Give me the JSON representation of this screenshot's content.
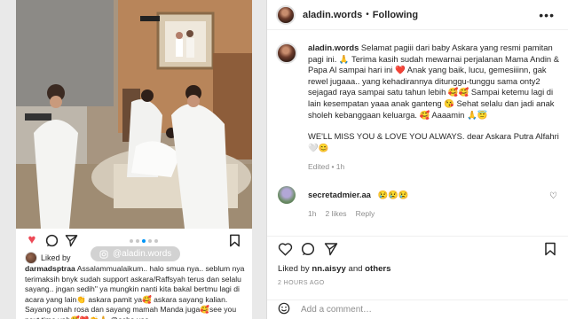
{
  "mobile": {
    "liked_by_prefix": "Liked by",
    "watermark": "@aladin.words",
    "caption_user": "darmadsptraa",
    "caption_text": "Assalammualaikum.. halo smua nya.. seblum nya terimaksih bnyk sudah support askara/Raffsyah terus dan selalu sayang.. jngan sedih\" ya mungkin nanti kita bakal bertmu lagi di acara yang lain👏 askara pamit ya🥰 askara sayang kalian. Sayang omah rosa dan sayang mamah Manda juga🥰see you next time yah🥰❤️👏🙏 @ocha.vaa",
    "icons": {
      "like": "heart-icon",
      "comment": "comment-icon",
      "share": "send-icon",
      "save": "bookmark-icon"
    }
  },
  "desktop": {
    "username": "aladin.words",
    "separator": "•",
    "follow_label": "Following",
    "more_label": "•••",
    "caption_user": "aladin.words",
    "caption_text": "Selamat pagiii dari baby Askara yang resmi pamitan pagi ini. 🙏 Terima kasih sudah mewarnai perjalanan Mama Andin & Papa Al sampai hari ini ❤️ Anak yang baik, lucu, gemesiiinn, gak rewel jugaaa.. yang kehadirannya ditunggu-tunggu sama onty2 sejagad raya sampai satu tahun lebih 🥰🥰 Sampai ketemu lagi di lain kesempatan yaaa anak ganteng 😘 Sehat selalu dan jadi anak sholeh kebanggaan keluarga. 🥰 Aaaamin 🙏😇",
    "caption_text_2": "WE'LL MISS YOU & LOVE YOU ALWAYS. dear Askara Putra Alfahri 🤍😊",
    "edited_label": "Edited • 1h",
    "comment": {
      "user": "secretadmier.aa",
      "text": "😢😢😢",
      "time": "1h",
      "likes": "2 likes",
      "reply": "Reply"
    },
    "liked_prefix": "Liked by",
    "liked_user": "nn.aisyy",
    "liked_and": "and",
    "liked_others": "others",
    "timestamp": "2 HOURS AGO",
    "add_comment_placeholder": "Add a comment…",
    "icons": {
      "like": "heart-outline-icon",
      "comment": "comment-icon",
      "share": "send-icon",
      "save": "bookmark-icon",
      "emoji": "emoji-icon"
    }
  },
  "colors": {
    "like_red": "#ed4956",
    "accent_blue": "#0095f6",
    "muted_gray": "#8e8e8e",
    "text": "#262626"
  }
}
